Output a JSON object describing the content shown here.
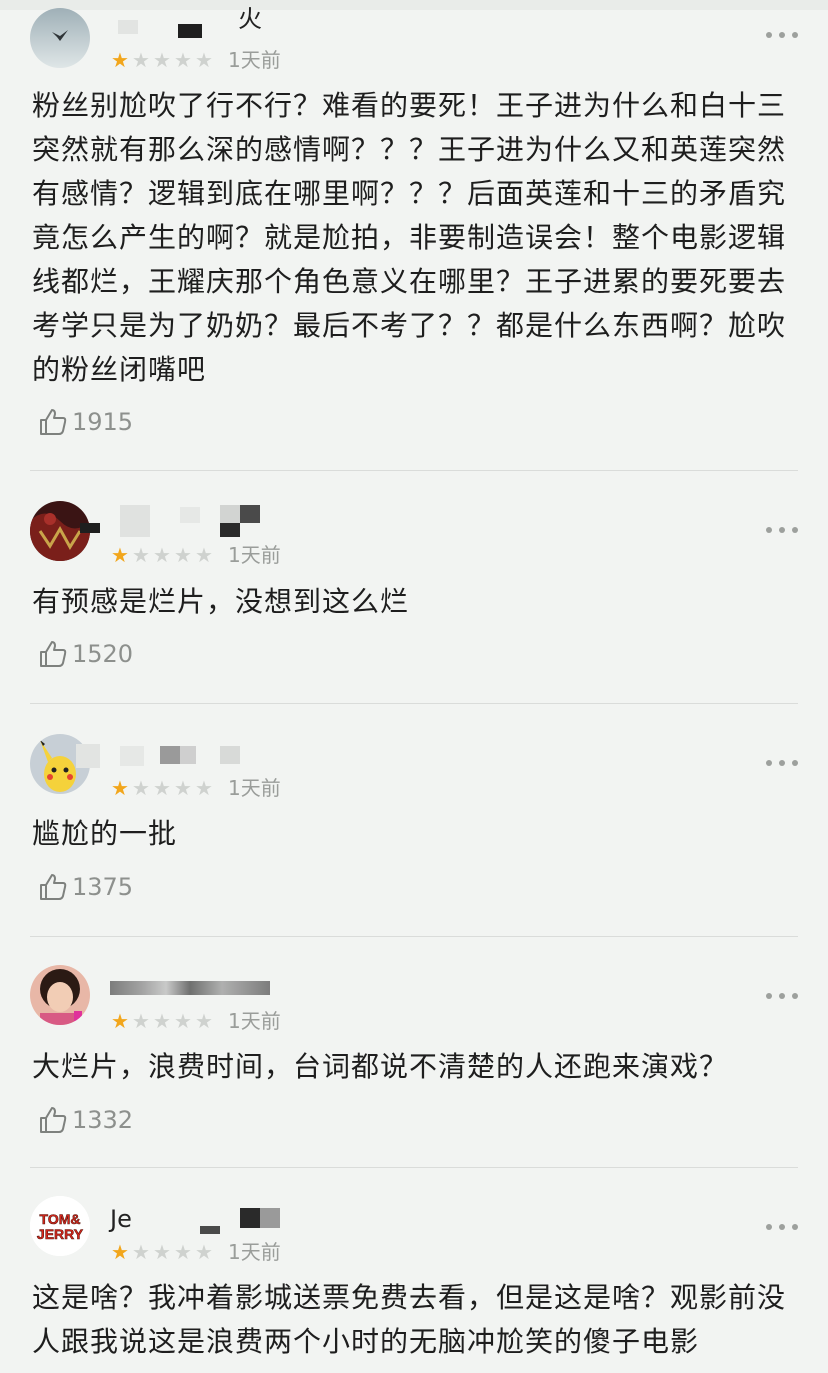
{
  "reviews": [
    {
      "username": "火",
      "avatar": "bird-sky-avatar",
      "rating": 1,
      "rating_max": 5,
      "time": "1天前",
      "text": "粉丝别尬吹了行不行？难看的要死！王子进为什么和白十三突然就有那么深的感情啊？？？王子进为什么又和英莲突然有感情？逻辑到底在哪里啊？？？后面英莲和十三的矛盾究竟怎么产生的啊？就是尬拍，非要制造误会！整个电影逻辑线都烂，王耀庆那个角色意义在哪里？王子进累的要死要去考学只是为了奶奶？最后不考了？？都是什么东西啊？尬吹的粉丝闭嘴吧",
      "likes": "1915"
    },
    {
      "username": "",
      "avatar": "dark-red-pattern-avatar",
      "rating": 1,
      "rating_max": 5,
      "time": "1天前",
      "text": "有预感是烂片，没想到这么烂",
      "likes": "1520"
    },
    {
      "username": "",
      "avatar": "pikachu-avatar",
      "rating": 1,
      "rating_max": 5,
      "time": "1天前",
      "text": "尴尬的一批",
      "likes": "1375"
    },
    {
      "username": "",
      "avatar": "woman-photo-avatar",
      "rating": 1,
      "rating_max": 5,
      "time": "1天前",
      "text": "大烂片，浪费时间，台词都说不清楚的人还跑来演戏？",
      "likes": "1332"
    },
    {
      "username": "Je",
      "avatar": "tom-and-jerry-logo-avatar",
      "avatar_logo_text": "TOM&JERRY",
      "rating": 1,
      "rating_max": 5,
      "time": "1天前",
      "text": "这是啥？我冲着影城送票免费去看，但是这是啥？观影前没人跟我说这是浪费两个小时的无脑冲尬笑的傻子电影",
      "likes": ""
    }
  ],
  "colors": {
    "background": "#f2f4f2",
    "star_on": "#f2a61c",
    "star_off": "#cfd2cf",
    "muted_text": "#9a9d9a"
  }
}
